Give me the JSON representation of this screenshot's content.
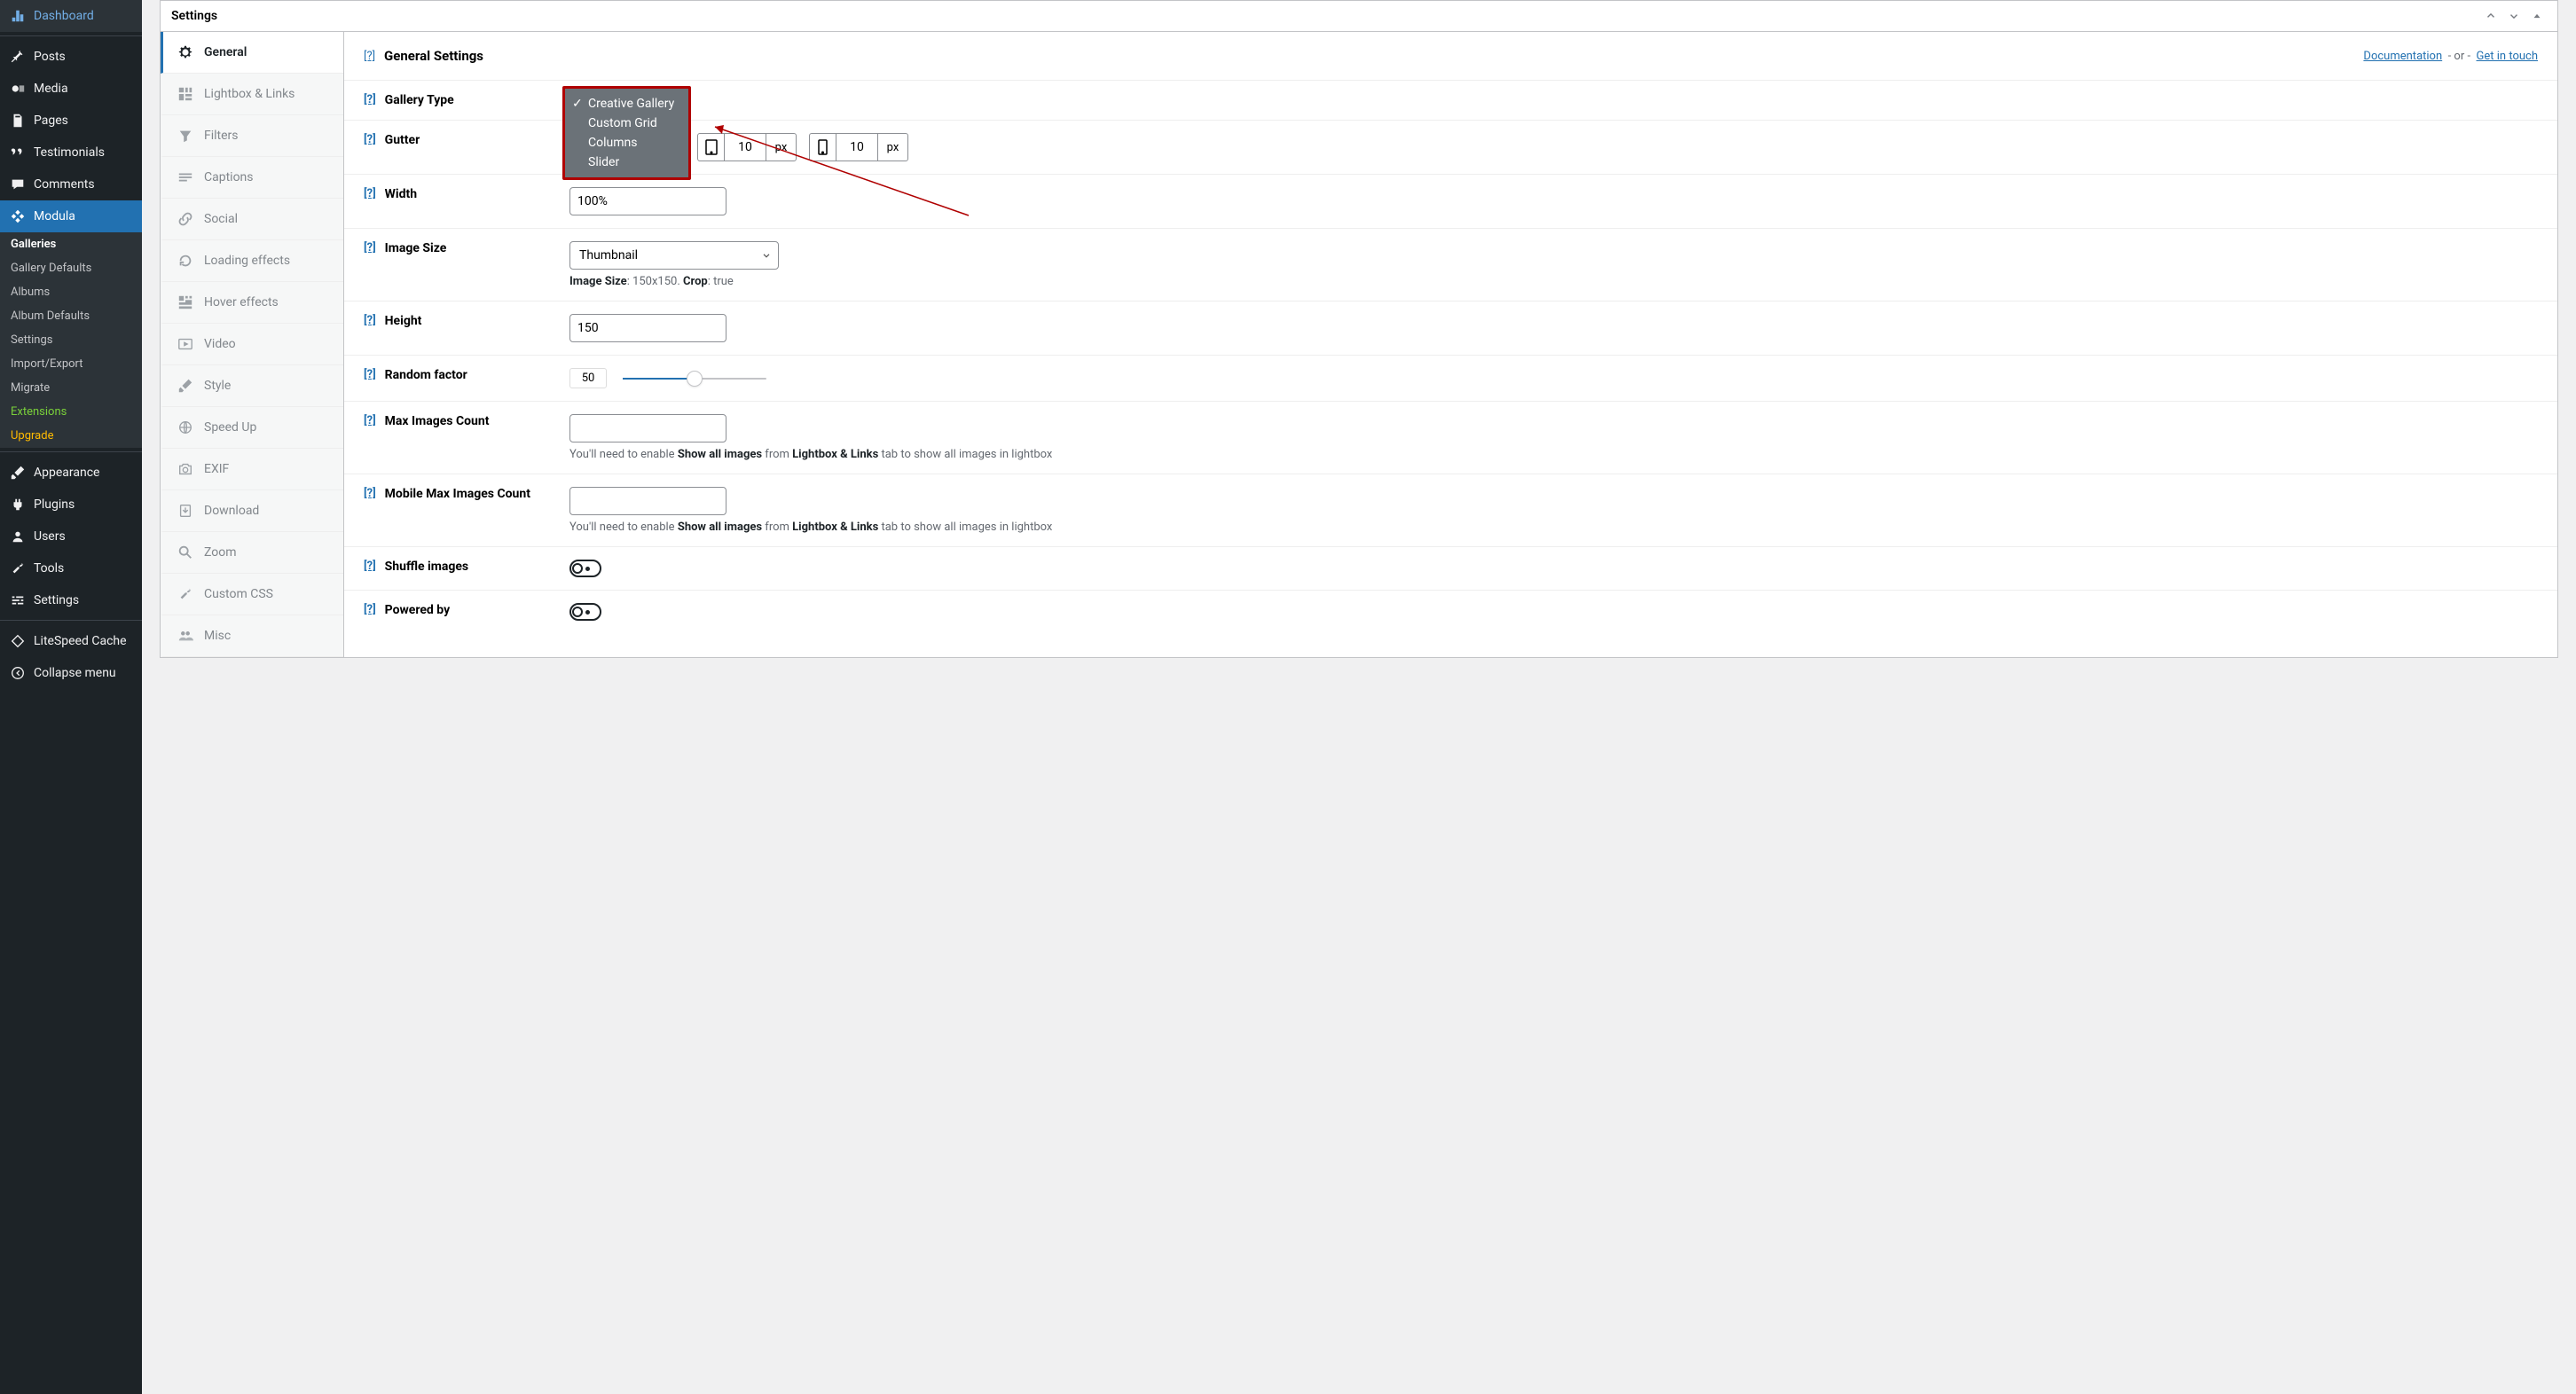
{
  "wp_menu": {
    "items": [
      {
        "label": "Dashboard",
        "icon": "dashboard"
      },
      {
        "label": "Posts",
        "icon": "pin"
      },
      {
        "label": "Media",
        "icon": "media"
      },
      {
        "label": "Pages",
        "icon": "pages"
      },
      {
        "label": "Testimonials",
        "icon": "quote"
      },
      {
        "label": "Comments",
        "icon": "comment"
      },
      {
        "label": "Modula",
        "icon": "modula",
        "active": true
      }
    ],
    "submenu": [
      {
        "label": "Galleries",
        "current": true
      },
      {
        "label": "Gallery Defaults"
      },
      {
        "label": "Albums"
      },
      {
        "label": "Album Defaults"
      },
      {
        "label": "Settings"
      },
      {
        "label": "Import/Export"
      },
      {
        "label": "Migrate"
      },
      {
        "label": "Extensions",
        "class": "ext"
      },
      {
        "label": "Upgrade",
        "class": "upg"
      }
    ],
    "items2": [
      {
        "label": "Appearance",
        "icon": "brush"
      },
      {
        "label": "Plugins",
        "icon": "plug"
      },
      {
        "label": "Users",
        "icon": "user"
      },
      {
        "label": "Tools",
        "icon": "wrench"
      },
      {
        "label": "Settings",
        "icon": "sliders"
      }
    ],
    "items3": [
      {
        "label": "LiteSpeed Cache",
        "icon": "diamond"
      },
      {
        "label": "Collapse menu",
        "icon": "collapse"
      }
    ]
  },
  "metabox": {
    "title": "Settings"
  },
  "tabs": [
    {
      "label": "General",
      "icon": "gear",
      "active": true
    },
    {
      "label": "Lightbox & Links",
      "icon": "grid"
    },
    {
      "label": "Filters",
      "icon": "filter"
    },
    {
      "label": "Captions",
      "icon": "captions"
    },
    {
      "label": "Social",
      "icon": "link"
    },
    {
      "label": "Loading effects",
      "icon": "reload"
    },
    {
      "label": "Hover effects",
      "icon": "hgrid"
    },
    {
      "label": "Video",
      "icon": "play"
    },
    {
      "label": "Style",
      "icon": "brush"
    },
    {
      "label": "Speed Up",
      "icon": "globe"
    },
    {
      "label": "EXIF",
      "icon": "camera"
    },
    {
      "label": "Download",
      "icon": "download"
    },
    {
      "label": "Zoom",
      "icon": "search"
    },
    {
      "label": "Custom CSS",
      "icon": "wrench"
    },
    {
      "label": "Misc",
      "icon": "people"
    }
  ],
  "panel": {
    "title": "General Settings",
    "doc_link": "Documentation",
    "or": "- or -",
    "contact_link": "Get in touch",
    "help_badge": "[?]"
  },
  "fields": {
    "gallery_type": {
      "label": "Gallery Type"
    },
    "gutter": {
      "label": "Gutter",
      "v1": "10",
      "v2": "10",
      "unit": "px"
    },
    "width": {
      "label": "Width",
      "value": "100%"
    },
    "image_size": {
      "label": "Image Size",
      "value": "Thumbnail",
      "desc_prefix": "Image Size",
      "size": ": 150x150. ",
      "crop_label": "Crop",
      "crop": ": true"
    },
    "height": {
      "label": "Height",
      "value": "150"
    },
    "random_factor": {
      "label": "Random factor",
      "value": "50"
    },
    "max_images": {
      "label": "Max Images Count",
      "desc1": "You'll need to enable ",
      "desc2": "Show all images",
      "desc3": " from ",
      "desc4": "Lightbox & Links",
      "desc5": " tab to show all images in lightbox"
    },
    "mobile_max": {
      "label": "Mobile Max Images Count",
      "desc1": "You'll need to enable ",
      "desc2": "Show all images",
      "desc3": " from ",
      "desc4": "Lightbox & Links",
      "desc5": " tab to show all images in lightbox"
    },
    "shuffle": {
      "label": "Shuffle images"
    },
    "powered": {
      "label": "Powered by"
    }
  },
  "dropdown": {
    "options": [
      "Creative Gallery",
      "Custom Grid",
      "Columns",
      "Slider"
    ],
    "selected": 0
  }
}
